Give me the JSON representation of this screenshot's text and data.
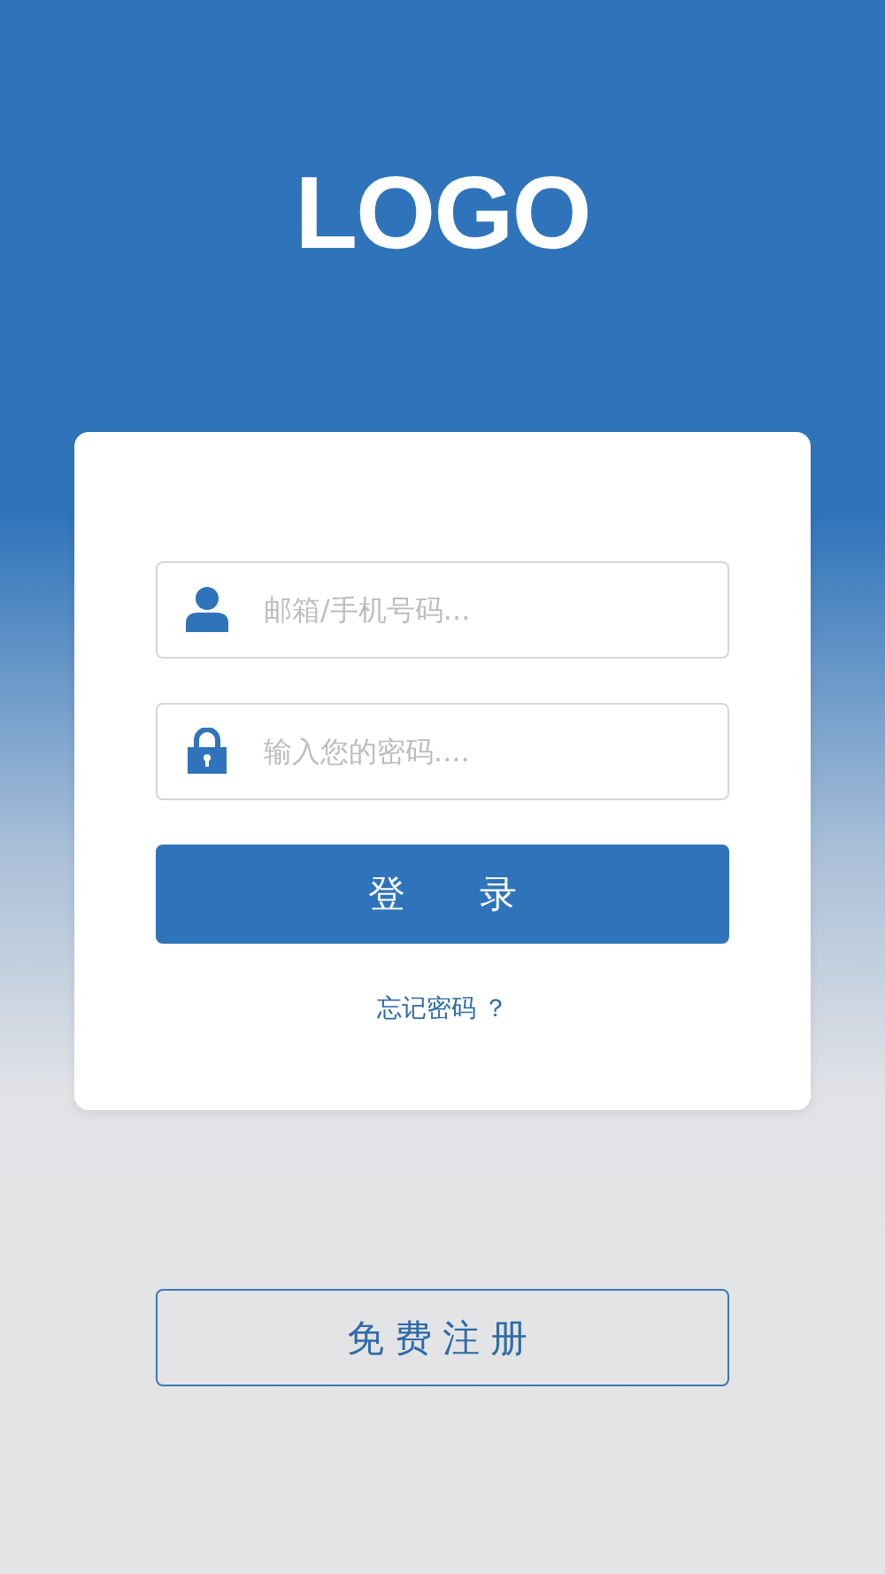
{
  "logo": "LOGO",
  "fields": [
    {
      "kind": "user",
      "placeholder": "邮箱/手机号码..."
    },
    {
      "kind": "lock",
      "placeholder": "输入您的密码...."
    }
  ],
  "login_button": "登　　录",
  "forgot_link": "忘记密码 ？",
  "register_button": "免费注册"
}
